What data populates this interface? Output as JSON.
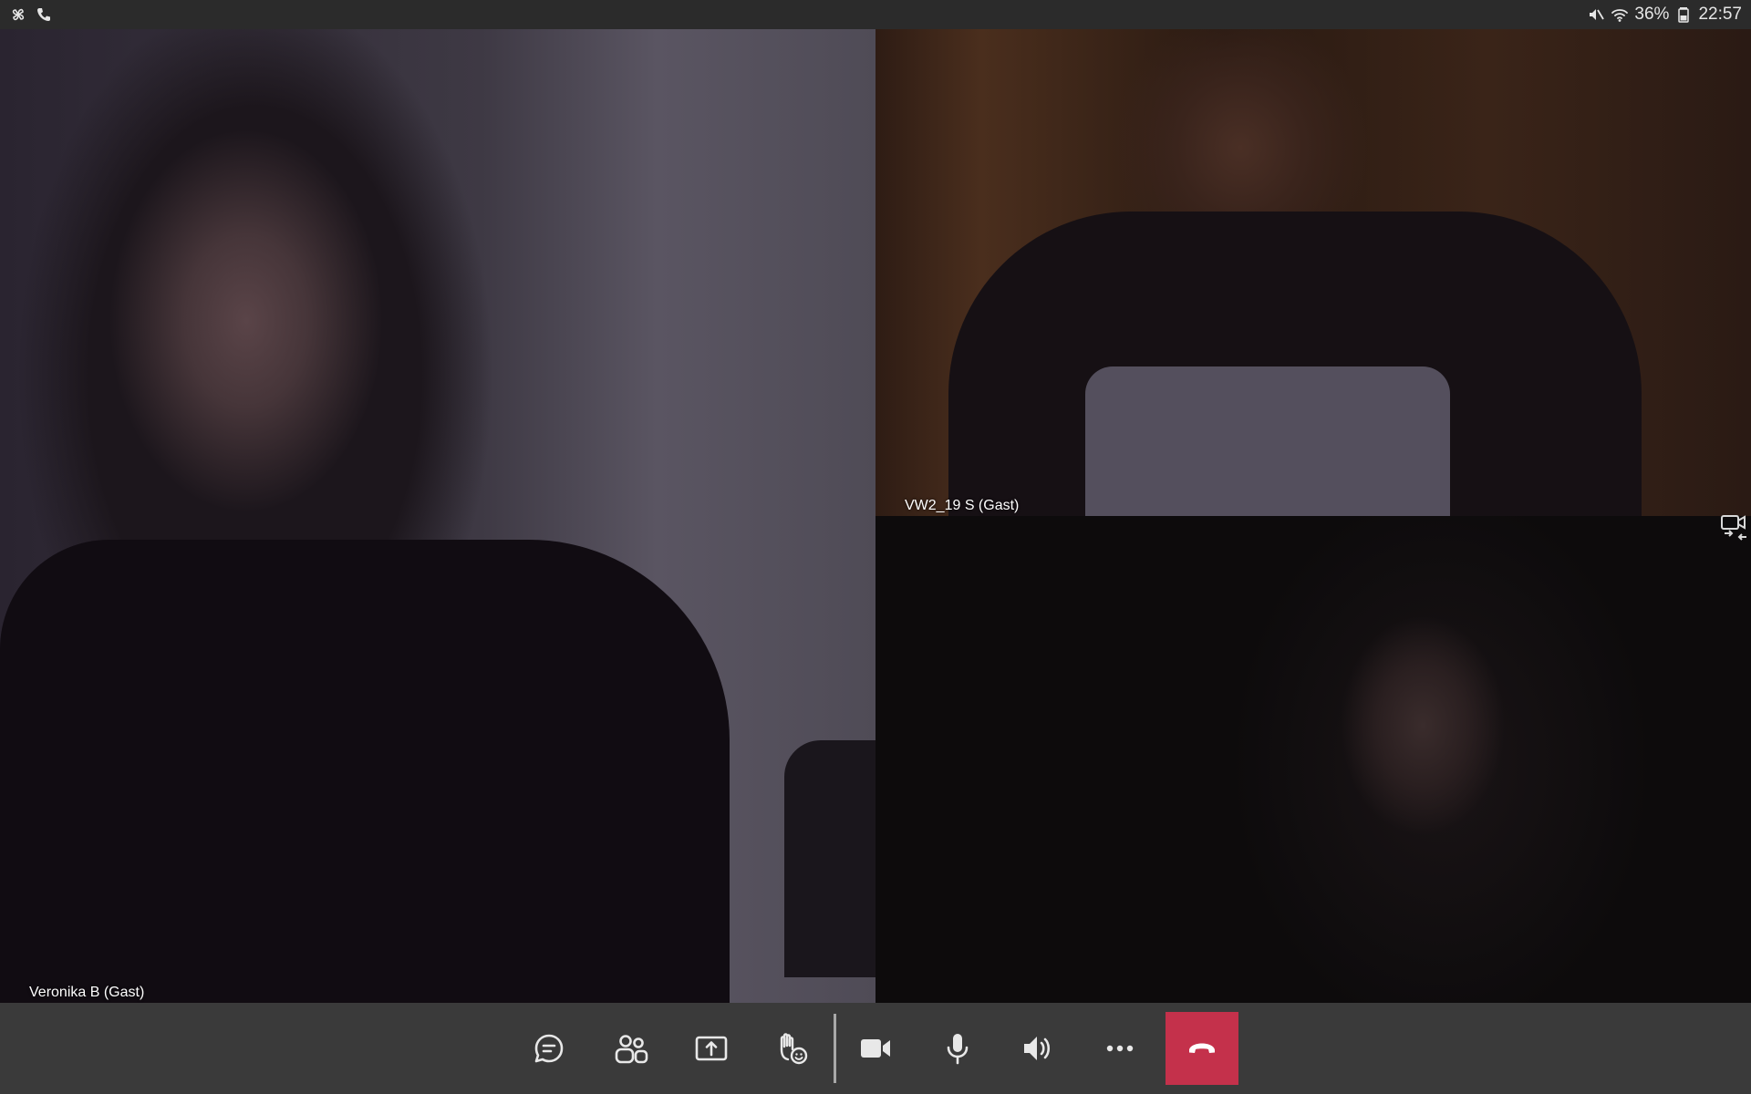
{
  "status_bar": {
    "left_icons": [
      "pinwheel-icon",
      "phone-icon"
    ],
    "right_icons": [
      "mute-icon",
      "wifi-icon",
      "battery-icon"
    ],
    "battery_percent": "36%",
    "time": "22:57"
  },
  "participants": [
    {
      "name": "Veronika B (Gast)"
    },
    {
      "name": "VW2_19 S (Gast)"
    },
    {
      "name": ""
    }
  ],
  "toolbar": {
    "buttons": [
      "chat-icon",
      "people-icon",
      "share-screen-icon",
      "raise-hand-icon",
      "video-camera-icon",
      "microphone-icon",
      "speaker-icon",
      "more-options-icon",
      "hang-up-icon"
    ],
    "hangup_color": "#c4314b"
  },
  "side_control": {
    "icon": "switch-camera-icon"
  }
}
